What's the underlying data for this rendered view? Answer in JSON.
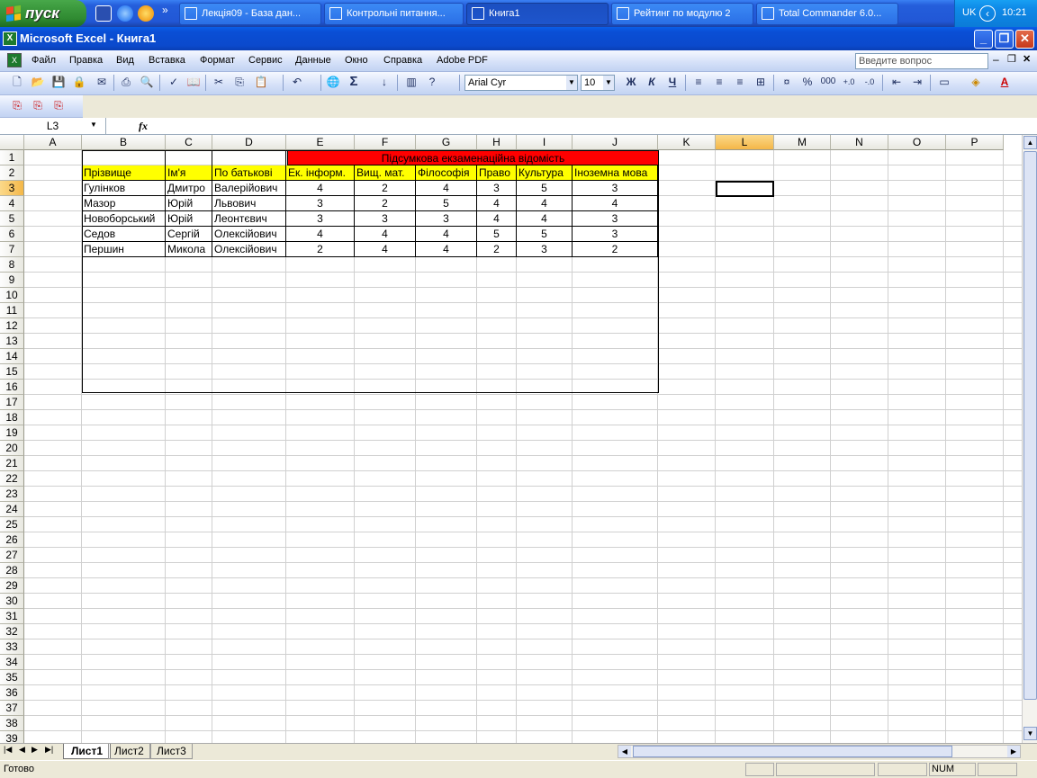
{
  "taskbar": {
    "start_label": "пуск",
    "tasks": [
      {
        "label": "Лекція09 - База дан..."
      },
      {
        "label": "Контрольні питання..."
      },
      {
        "label": "Книга1"
      },
      {
        "label": "Рейтинг по модулю 2"
      },
      {
        "label": "Total Commander 6.0..."
      }
    ],
    "lang": "UK",
    "time": "10:21",
    "overflow": "»"
  },
  "window": {
    "title": "Microsoft Excel - Книга1"
  },
  "menu": {
    "items": [
      "Файл",
      "Правка",
      "Вид",
      "Вставка",
      "Формат",
      "Сервис",
      "Данные",
      "Окно",
      "Справка",
      "Adobe PDF"
    ],
    "help_placeholder": "Введите вопрос"
  },
  "toolbar": {
    "font": "Arial Cyr",
    "size": "10",
    "bold": "Ж",
    "italic": "К",
    "underline": "Ч",
    "percent": "%",
    "thousands": "000"
  },
  "formula_bar": {
    "name_box": "L3",
    "fx": "fx",
    "value": ""
  },
  "columns": [
    "A",
    "B",
    "C",
    "D",
    "E",
    "F",
    "G",
    "H",
    "I",
    "J",
    "K",
    "L",
    "M",
    "N",
    "O",
    "P"
  ],
  "selected_column": "L",
  "selected_row": "3",
  "sheet": {
    "title": "Підсумкова екзаменаційна відомість",
    "headers": [
      "Прізвище",
      "Ім'я",
      "По батькові",
      "Ек. інформ.",
      "Вищ. мат.",
      "Філософія",
      "Право",
      "Культура",
      "Іноземна мова"
    ],
    "rows": [
      [
        "Гулінков",
        "Дмитро",
        "Валерійович",
        "4",
        "2",
        "4",
        "3",
        "5",
        "3"
      ],
      [
        "Мазор",
        "Юрій",
        "Львович",
        "3",
        "2",
        "5",
        "4",
        "4",
        "4"
      ],
      [
        "Новоборський",
        "Юрій",
        "Леонтєвич",
        "3",
        "3",
        "3",
        "4",
        "4",
        "3"
      ],
      [
        "Седов",
        "Сергій",
        "Олексійович",
        "4",
        "4",
        "4",
        "5",
        "5",
        "3"
      ],
      [
        "Першин",
        "Микола",
        "Олексійович",
        "2",
        "4",
        "4",
        "2",
        "3",
        "2"
      ]
    ]
  },
  "colors": {
    "title_fill": "#ff0000",
    "header_fill": "#ffff00",
    "selection": "#f4b748"
  },
  "sheet_tabs": [
    "Лист1",
    "Лист2",
    "Лист3"
  ],
  "status": {
    "ready": "Готово",
    "num": "NUM"
  }
}
